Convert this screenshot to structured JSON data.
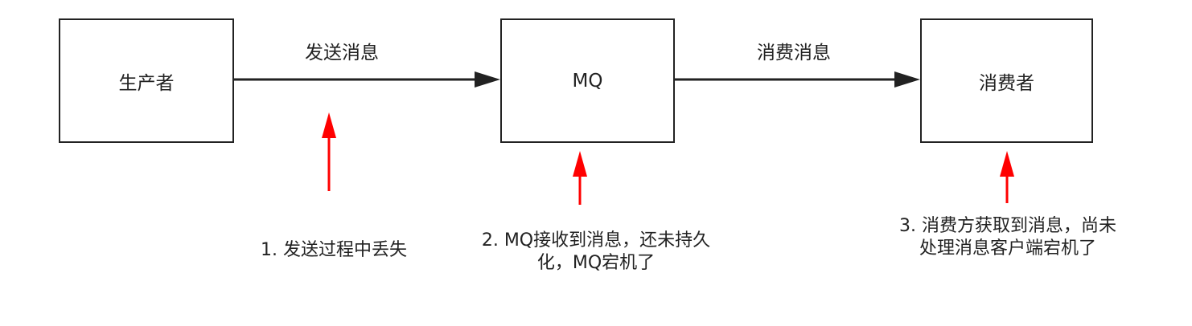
{
  "nodes": {
    "producer": "生产者",
    "mq": "MQ",
    "consumer": "消费者"
  },
  "edges": {
    "send": "发送消息",
    "consume": "消费消息"
  },
  "notes": {
    "send_loss": "1. 发送过程中丢失",
    "mq_loss": "2. MQ接收到消息，还未持久化，MQ宕机了",
    "consumer_loss": "3. 消费方获取到消息，尚未处理消息客户端宕机了"
  },
  "colors": {
    "line": "#222222",
    "highlight": "#ff0000"
  }
}
